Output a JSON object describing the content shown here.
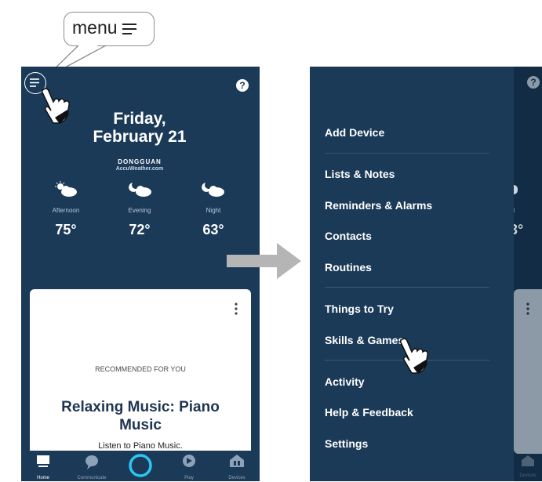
{
  "callout": {
    "label": "menu"
  },
  "arrow_color": "#b5b5b5",
  "home": {
    "help_glyph": "?",
    "date_line1": "Friday,",
    "date_line2": "February 21",
    "location": "DONGGUAN",
    "source": "AccuWeather.com",
    "forecast": [
      {
        "period": "Afternoon",
        "temp": "75°",
        "icon": "partly-sunny-icon"
      },
      {
        "period": "Evening",
        "temp": "72°",
        "icon": "cloudy-moon-icon"
      },
      {
        "period": "Night",
        "temp": "63°",
        "icon": "cloudy-moon-icon"
      }
    ],
    "card": {
      "recommended": "RECOMMENDED FOR YOU",
      "title_line1": "Relaxing Music: Piano",
      "title_line2": "Music",
      "subtitle": "Listen to Piano Music."
    },
    "nav": [
      {
        "label": "Home",
        "icon": "home-icon"
      },
      {
        "label": "Communicate",
        "icon": "chat-icon"
      },
      {
        "label": "",
        "icon": "alexa-icon"
      },
      {
        "label": "Play",
        "icon": "play-icon"
      },
      {
        "label": "Devices",
        "icon": "devices-icon"
      }
    ]
  },
  "drawer": {
    "items": [
      "Add Device",
      "Lists & Notes",
      "Reminders & Alarms",
      "Contacts",
      "Routines",
      "Things to Try",
      "Skills & Games",
      "Activity",
      "Help & Feedback",
      "Settings"
    ],
    "behind": {
      "period_fragment": "ht",
      "temp_fragment": "3°",
      "nav_label": "Devices"
    }
  },
  "colors": {
    "app_bg": "#1b3a58",
    "accent": "#2ec5f0"
  }
}
